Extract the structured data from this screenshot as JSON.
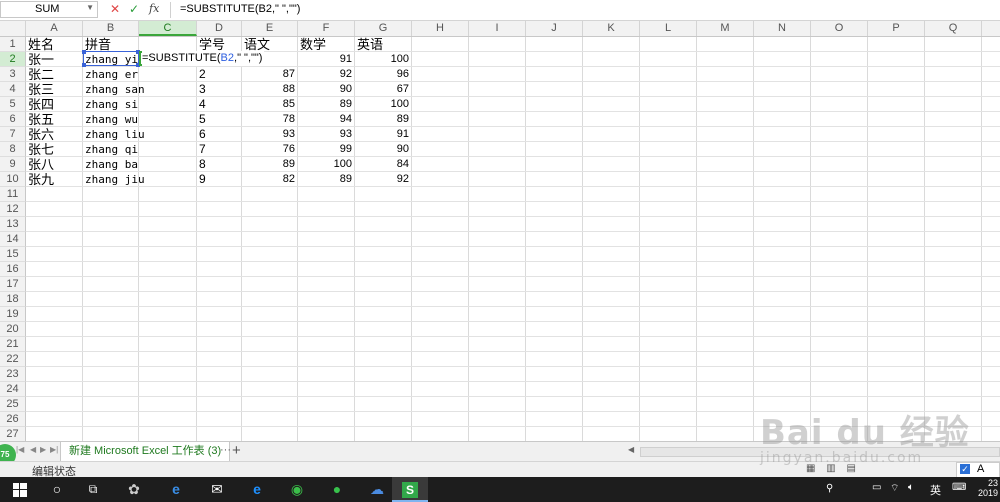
{
  "formula_bar": {
    "name_box": "SUM",
    "cancel_icon": "✕",
    "confirm_icon": "✓",
    "fx_label": "fx",
    "formula": "=SUBSTITUTE(B2,\" \",\"\")"
  },
  "columns": [
    "A",
    "B",
    "C",
    "D",
    "E",
    "F",
    "G",
    "H",
    "I",
    "J",
    "K",
    "L",
    "M",
    "N",
    "O",
    "P",
    "Q"
  ],
  "selected_column": "C",
  "row_numbers": [
    "1",
    "2",
    "3",
    "4",
    "5",
    "6",
    "7",
    "8",
    "9",
    "10",
    "11",
    "12",
    "13",
    "14",
    "15",
    "16",
    "17",
    "18",
    "19",
    "20",
    "21",
    "22",
    "23",
    "24",
    "25",
    "26",
    "27"
  ],
  "selected_row": "2",
  "headers": {
    "name": "姓名",
    "pinyin": "拼音",
    "id": "学号",
    "chinese": "语文",
    "math": "数学",
    "english": "英语"
  },
  "rows": [
    {
      "name": "张一",
      "pinyin": "zhang yi",
      "id": "",
      "chinese": "",
      "math": "91",
      "english": "100"
    },
    {
      "name": "张二",
      "pinyin": "zhang er",
      "id": "2",
      "chinese": "87",
      "math": "92",
      "english": "96"
    },
    {
      "name": "张三",
      "pinyin": "zhang san",
      "id": "3",
      "chinese": "88",
      "math": "90",
      "english": "67"
    },
    {
      "name": "张四",
      "pinyin": "zhang si",
      "id": "4",
      "chinese": "85",
      "math": "89",
      "english": "100"
    },
    {
      "name": "张五",
      "pinyin": "zhang wu",
      "id": "5",
      "chinese": "78",
      "math": "94",
      "english": "89"
    },
    {
      "name": "张六",
      "pinyin": "zhang liu",
      "id": "6",
      "chinese": "93",
      "math": "93",
      "english": "91"
    },
    {
      "name": "张七",
      "pinyin": "zhang qi",
      "id": "7",
      "chinese": "76",
      "math": "99",
      "english": "90"
    },
    {
      "name": "张八",
      "pinyin": "zhang ba",
      "id": "8",
      "chinese": "89",
      "math": "100",
      "english": "84"
    },
    {
      "name": "张九",
      "pinyin": "zhang jiu",
      "id": "9",
      "chinese": "82",
      "math": "89",
      "english": "92"
    }
  ],
  "editing": {
    "prefix": "=SUBSTITUTE(",
    "ref": "B2",
    "suffix": ",\" \",\"\")"
  },
  "sheet_tabs": {
    "active": "新建 Microsoft Excel 工作表 (3)",
    "more": "···",
    "add": "+"
  },
  "zoom_badge": "75",
  "status": {
    "mode": "编辑状态"
  },
  "ime": {
    "lang": "A",
    "tray_lang": "英"
  },
  "clock": {
    "time": "23",
    "year": "2019"
  },
  "watermark": {
    "brand": "Bai du 经验",
    "url": "jingyan.baidu.com"
  },
  "taskbar_icons": [
    "windows-start",
    "search",
    "task-view",
    "pinwheel",
    "edge",
    "mail",
    "ie",
    "360-browser",
    "wechat",
    "baidu-netdisk",
    "wps-spreadsheet"
  ]
}
